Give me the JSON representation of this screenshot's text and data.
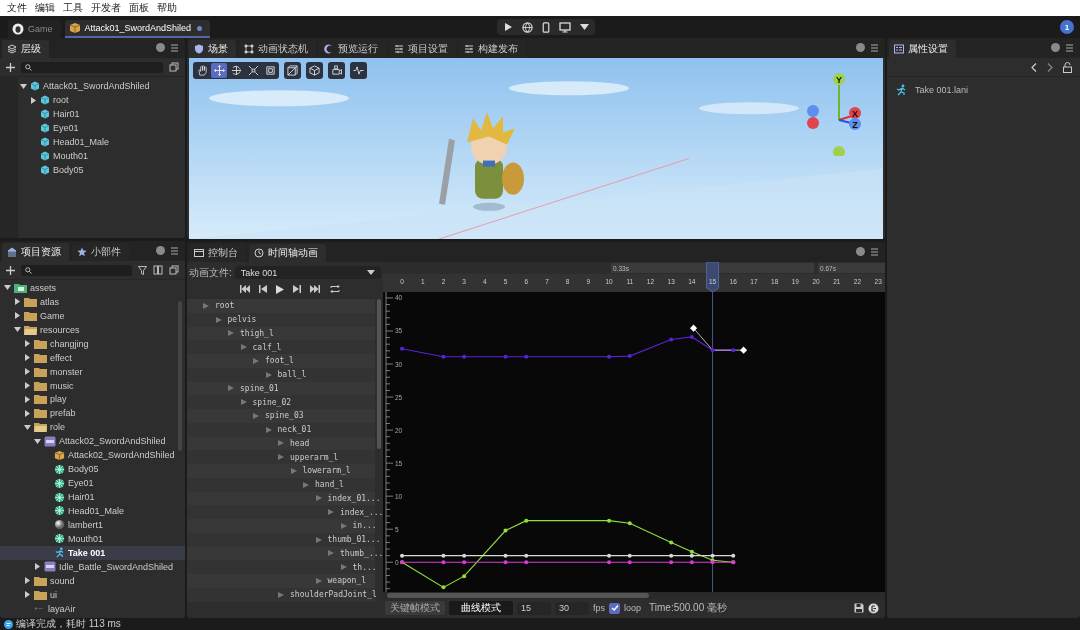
{
  "menu": [
    "文件",
    "编辑",
    "工具",
    "开发者",
    "面板",
    "帮助"
  ],
  "doc_tabs": [
    {
      "label": "Game",
      "selected": false,
      "modified": false
    },
    {
      "label": "Attack01_SwordAndShiled",
      "selected": true,
      "modified": true
    }
  ],
  "badge": "1",
  "hierarchy": {
    "tab": {
      "label": "层级",
      "selected": true
    },
    "tree": [
      {
        "label": "Attack01_SwordAndShiled",
        "expandable": true,
        "expanded": true,
        "children": [
          {
            "label": "root",
            "expandable": true,
            "expanded": false
          },
          {
            "label": "Hair01",
            "expandable": false,
            "expanded": false
          },
          {
            "label": "Eye01",
            "expandable": false,
            "expanded": false
          },
          {
            "label": "Head01_Male",
            "expandable": false,
            "expanded": false
          },
          {
            "label": "Mouth01",
            "expandable": false,
            "expanded": false
          },
          {
            "label": "Body05",
            "expandable": false,
            "expanded": false
          }
        ]
      }
    ]
  },
  "assets": {
    "tabs": [
      {
        "label": "项目资源",
        "selected": true
      },
      {
        "label": "小部件",
        "selected": false
      }
    ],
    "tree": [
      {
        "label": "assets",
        "kind": "root",
        "expandable": true,
        "expanded": true,
        "selected": false,
        "children": [
          {
            "label": "atlas",
            "kind": "folder",
            "expandable": true,
            "expanded": false,
            "selected": false
          },
          {
            "label": "Game",
            "kind": "folder",
            "expandable": true,
            "expanded": false,
            "selected": false
          },
          {
            "label": "resources",
            "kind": "folder",
            "expandable": true,
            "expanded": true,
            "selected": false,
            "children": [
              {
                "label": "changjing",
                "kind": "folder",
                "expandable": true,
                "expanded": false,
                "selected": false
              },
              {
                "label": "effect",
                "kind": "folder",
                "expandable": true,
                "expanded": false,
                "selected": false
              },
              {
                "label": "monster",
                "kind": "folder",
                "expandable": true,
                "expanded": false,
                "selected": false
              },
              {
                "label": "music",
                "kind": "folder",
                "expandable": true,
                "expanded": false,
                "selected": false
              },
              {
                "label": "play",
                "kind": "folder",
                "expandable": true,
                "expanded": false,
                "selected": false
              },
              {
                "label": "prefab",
                "kind": "folder",
                "expandable": true,
                "expanded": false,
                "selected": false
              },
              {
                "label": "role",
                "kind": "folder",
                "expandable": true,
                "expanded": true,
                "selected": false,
                "children": [
                  {
                    "label": "Attack02_SwordAndShiled",
                    "kind": "model",
                    "expandable": true,
                    "expanded": true,
                    "selected": false,
                    "children": [
                      {
                        "label": "Attack02_SwordAndShiled",
                        "kind": "prefab",
                        "expandable": false,
                        "expanded": false,
                        "selected": false
                      },
                      {
                        "label": "Body05",
                        "kind": "mesh",
                        "expandable": false,
                        "expanded": false,
                        "selected": false
                      },
                      {
                        "label": "Eye01",
                        "kind": "mesh",
                        "expandable": false,
                        "expanded": false,
                        "selected": false
                      },
                      {
                        "label": "Hair01",
                        "kind": "mesh",
                        "expandable": false,
                        "expanded": false,
                        "selected": false
                      },
                      {
                        "label": "Head01_Male",
                        "kind": "mesh",
                        "expandable": false,
                        "expanded": false,
                        "selected": false
                      },
                      {
                        "label": "lambert1",
                        "kind": "material",
                        "expandable": false,
                        "expanded": false,
                        "selected": false
                      },
                      {
                        "label": "Mouth01",
                        "kind": "mesh",
                        "expandable": false,
                        "expanded": false,
                        "selected": false
                      },
                      {
                        "label": "Take 001",
                        "kind": "animation",
                        "expandable": false,
                        "expanded": false,
                        "selected": true
                      }
                    ]
                  },
                  {
                    "label": "Idle_Battle_SwordAndShiled",
                    "kind": "model",
                    "expandable": true,
                    "expanded": false,
                    "selected": false
                  }
                ]
              },
              {
                "label": "sound",
                "kind": "folder",
                "expandable": true,
                "expanded": false,
                "selected": false
              },
              {
                "label": "ui",
                "kind": "folder",
                "expandable": true,
                "expanded": false,
                "selected": false
              },
              {
                "label": "layaAir",
                "kind": "file",
                "expandable": false,
                "expanded": false,
                "selected": false
              }
            ]
          }
        ]
      }
    ]
  },
  "scene": {
    "tabs": [
      {
        "label": "场景",
        "selected": true
      },
      {
        "label": "动画状态机",
        "selected": false
      },
      {
        "label": "预览运行",
        "selected": false
      },
      {
        "label": "项目设置",
        "selected": false
      },
      {
        "label": "构建发布",
        "selected": false
      }
    ],
    "tools": [
      {
        "kind": "hand",
        "selected": false
      },
      {
        "kind": "move",
        "selected": true
      },
      {
        "kind": "rotate",
        "selected": false
      },
      {
        "kind": "scale",
        "selected": false
      },
      {
        "kind": "rect",
        "selected": false
      }
    ],
    "view_buttons": [
      {
        "kind": "perspective"
      },
      {
        "kind": "cube"
      },
      {
        "kind": "camera"
      },
      {
        "kind": "stats"
      }
    ],
    "gizmo_axes": [
      "Y",
      "X",
      "Z"
    ]
  },
  "timeline": {
    "tabs": [
      {
        "label": "控制台",
        "selected": false
      },
      {
        "label": "时间轴动画",
        "selected": true
      }
    ],
    "file_label": "动画文件:",
    "file": "Take 001",
    "bones": [
      {
        "label": "root",
        "children": [
          {
            "label": "pelvis",
            "children": [
              {
                "label": "thigh_l",
                "children": [
                  {
                    "label": "calf_l",
                    "children": [
                      {
                        "label": "foot_l",
                        "children": [
                          {
                            "label": "ball_l"
                          }
                        ]
                      }
                    ]
                  }
                ]
              },
              {
                "label": "spine_01",
                "children": [
                  {
                    "label": "spine_02",
                    "children": [
                      {
                        "label": "spine_03",
                        "children": [
                          {
                            "label": "neck_01",
                            "children": [
                              {
                                "label": "head"
                              },
                              {
                                "label": "upperarm_l",
                                "children": [
                                  {
                                    "label": "lowerarm_l",
                                    "children": [
                                      {
                                        "label": "hand_l",
                                        "children": [
                                          {
                                            "label": "index_01...",
                                            "children": [
                                              {
                                                "label": "index_...",
                                                "children": [
                                                  {
                                                    "label": "in..."
                                                  }
                                                ]
                                              }
                                            ]
                                          },
                                          {
                                            "label": "thumb_01...",
                                            "children": [
                                              {
                                                "label": "thumb_...",
                                                "children": [
                                                  {
                                                    "label": "th..."
                                                  }
                                                ]
                                              }
                                            ]
                                          },
                                          {
                                            "label": "weapon_l"
                                          }
                                        ]
                                      }
                                    ]
                                  }
                                ]
                              },
                              {
                                "label": "shoulderPadJoint_l"
                              }
                            ]
                          }
                        ]
                      }
                    ]
                  }
                ]
              }
            ]
          }
        ]
      }
    ],
    "ruler_times": [
      "0.33s",
      "0.67s"
    ],
    "chart_data": {
      "type": "line",
      "xlim": [
        -0.92,
        23.33
      ],
      "ylim": [
        -4.5,
        40.9
      ],
      "ref_lines": [
        {
          "axis": "x",
          "value": 15
        }
      ],
      "xticks": [
        0,
        1,
        2,
        3,
        4,
        5,
        6,
        7,
        8,
        9,
        10,
        11,
        12,
        13,
        14,
        15,
        16,
        17,
        18,
        19,
        20,
        21,
        22,
        23
      ],
      "yticks": [
        0,
        5,
        10,
        15,
        20,
        25,
        30,
        35,
        40
      ],
      "x": [
        0,
        2,
        3,
        5,
        6,
        10,
        11,
        13,
        14,
        15,
        16
      ],
      "series": [
        {
          "color": "#5a22d8",
          "values": [
            32.3,
            31.1,
            31.1,
            31.1,
            31.1,
            31.1,
            31.2,
            33.7,
            34.1,
            32.1,
            32.1
          ]
        },
        {
          "color": "#8fe03c",
          "values": [
            0,
            -3.8,
            -2.1,
            4.8,
            6.3,
            6.3,
            5.9,
            3,
            1.6,
            0.3,
            0
          ]
        },
        {
          "color": "#d83ad8",
          "values": [
            0,
            0,
            0,
            0,
            0,
            0,
            0,
            0,
            0,
            0,
            0
          ]
        },
        {
          "color": "#d8d8d8",
          "values": [
            1,
            1,
            1,
            1,
            1,
            1,
            1,
            1,
            1,
            1,
            1
          ]
        }
      ]
    },
    "modes": [
      {
        "label": "关键帧模式",
        "selected": false
      },
      {
        "label": "曲线模式",
        "selected": true
      }
    ],
    "frame": "15",
    "fps_value": "30",
    "fps_label": "fps",
    "loop": {
      "label": "loop",
      "checked": true
    },
    "time": "Time:500.00 毫秒"
  },
  "properties": {
    "tab": {
      "label": "属性设置",
      "selected": true
    },
    "item": "Take 001.lani"
  },
  "status": "编译完成，耗时 113 ms"
}
